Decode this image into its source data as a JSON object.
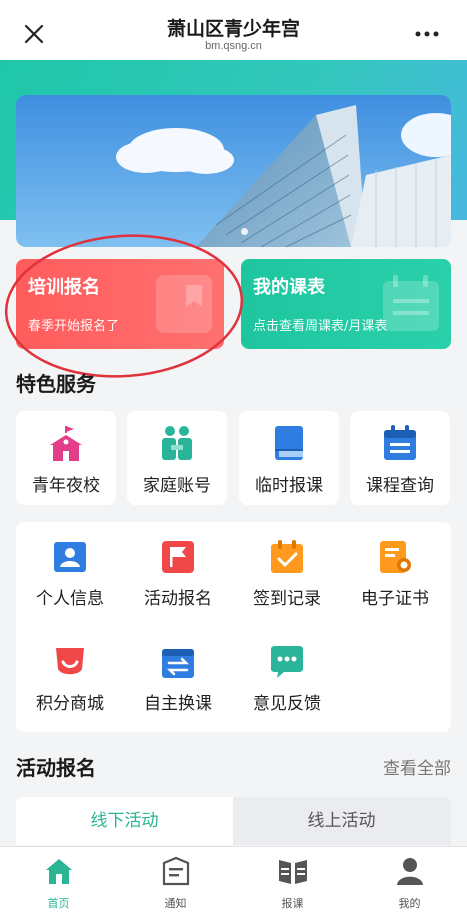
{
  "header": {
    "title": "萧山区青少年宫",
    "domain": "bm.qsng.cn"
  },
  "cards": [
    {
      "title": "培训报名",
      "subtitle": "春季开始报名了"
    },
    {
      "title": "我的课表",
      "subtitle": "点击查看周课表/月课表"
    }
  ],
  "featured": {
    "title": "特色服务",
    "items": [
      {
        "label": "青年夜校",
        "icon": "school-icon"
      },
      {
        "label": "家庭账号",
        "icon": "family-icon"
      },
      {
        "label": "临时报课",
        "icon": "book-icon"
      },
      {
        "label": "课程查询",
        "icon": "calendar-icon"
      }
    ]
  },
  "services": [
    {
      "label": "个人信息",
      "icon": "id-card-icon"
    },
    {
      "label": "活动报名",
      "icon": "flag-icon"
    },
    {
      "label": "签到记录",
      "icon": "checkin-calendar-icon"
    },
    {
      "label": "电子证书",
      "icon": "certificate-icon"
    },
    {
      "label": "积分商城",
      "icon": "mall-icon"
    },
    {
      "label": "自主换课",
      "icon": "swap-icon"
    },
    {
      "label": "意见反馈",
      "icon": "feedback-icon"
    }
  ],
  "activity": {
    "title": "活动报名",
    "see_all": "查看全部",
    "tabs": [
      {
        "label": "线下活动"
      },
      {
        "label": "线上活动"
      }
    ]
  },
  "bottom_nav": [
    {
      "label": "首页",
      "icon": "home-icon"
    },
    {
      "label": "通知",
      "icon": "notice-icon"
    },
    {
      "label": "报课",
      "icon": "course-icon"
    },
    {
      "label": "我的",
      "icon": "user-icon"
    }
  ],
  "colors": {
    "accent": "#2bb594",
    "red_card": "#ff5c5c",
    "teal_card": "#1ec6a0",
    "annotation": "#e0323c"
  }
}
